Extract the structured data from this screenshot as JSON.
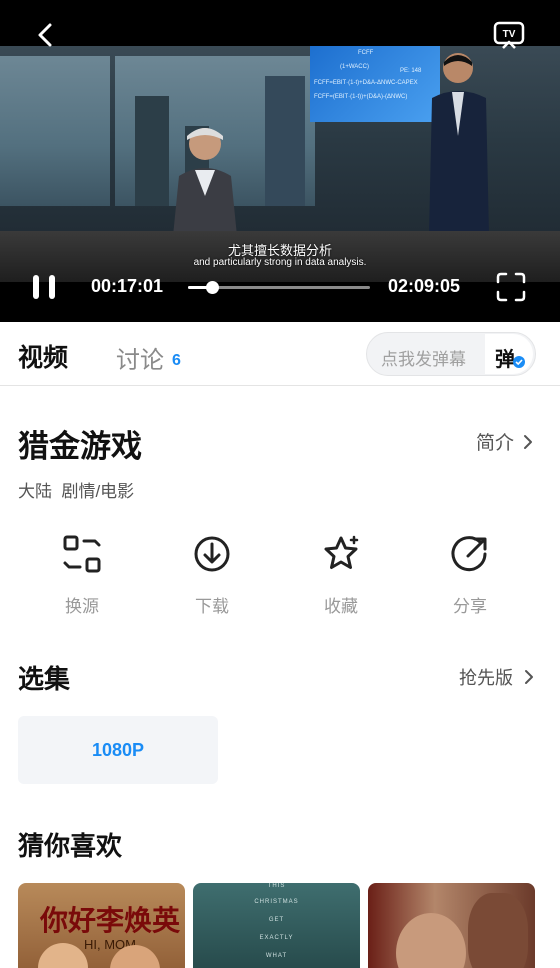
{
  "player": {
    "subtitle_cn": "尤其擅长数据分析",
    "subtitle_en": "and particularly strong in data analysis.",
    "current_time": "00:17:01",
    "total_time": "02:09:05",
    "progress": 0.132,
    "board_formula": "FCFF",
    "board_pe": "PE: 148"
  },
  "tabs": {
    "video": "视频",
    "discuss": "讨论",
    "discuss_count": "6",
    "danmu_placeholder": "点我发弹幕",
    "danmu_toggle": "弹"
  },
  "info": {
    "title": "猎金游戏",
    "intro": "简介",
    "meta": "大陆  剧情/电影"
  },
  "actions": [
    {
      "label": "换源",
      "icon": "switch-source-icon"
    },
    {
      "label": "下载",
      "icon": "download-icon"
    },
    {
      "label": "收藏",
      "icon": "favorite-star-icon"
    },
    {
      "label": "分享",
      "icon": "share-icon"
    }
  ],
  "episodes": {
    "heading": "选集",
    "early_link": "抢先版",
    "items": [
      "1080P"
    ]
  },
  "recommend": {
    "heading": "猜你喜欢",
    "posters": [
      {
        "title": "你好李焕英",
        "subtitle": "HI, MOM"
      },
      {
        "lines": [
          "THIS",
          "CHRISTMAS",
          "GET",
          "EXACTLY",
          "WHAT"
        ]
      },
      {}
    ]
  },
  "colors": {
    "accent": "#1a8cf5",
    "muted": "#999999"
  }
}
